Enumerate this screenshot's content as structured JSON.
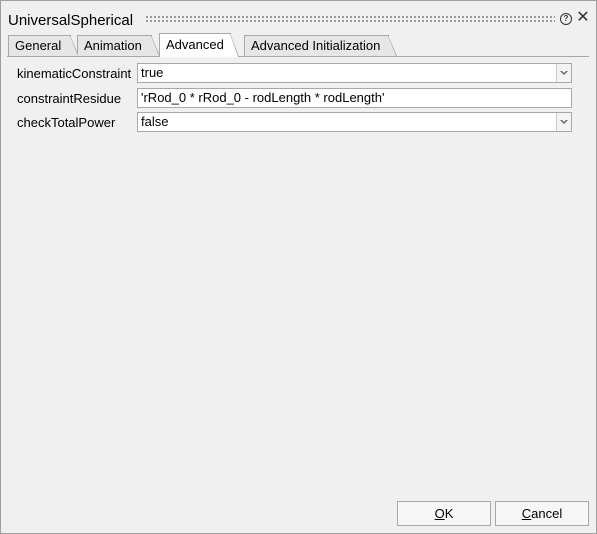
{
  "dialog": {
    "title": "UniversalSpherical",
    "help_glyph": "?",
    "close_glyph": "✕"
  },
  "tabs": [
    {
      "label": "General",
      "active": false
    },
    {
      "label": "Animation",
      "active": false
    },
    {
      "label": "Advanced",
      "active": true
    },
    {
      "label": "Advanced Initialization",
      "active": false
    }
  ],
  "params": [
    {
      "label": "kinematicConstraint",
      "value": "true",
      "type": "combo"
    },
    {
      "label": "constraintResidue",
      "value": "'rRod_0 * rRod_0 - rodLength * rodLength'",
      "type": "text"
    },
    {
      "label": "checkTotalPower",
      "value": "false",
      "type": "combo"
    }
  ],
  "buttons": {
    "ok_mnemonic": "O",
    "ok_rest": "K",
    "cancel_mnemonic": "C",
    "cancel_rest": "ancel"
  },
  "icons": {
    "help": "help-icon",
    "close": "close-icon",
    "dropdown": "chevron-down-icon",
    "grip": "drag-grip"
  }
}
